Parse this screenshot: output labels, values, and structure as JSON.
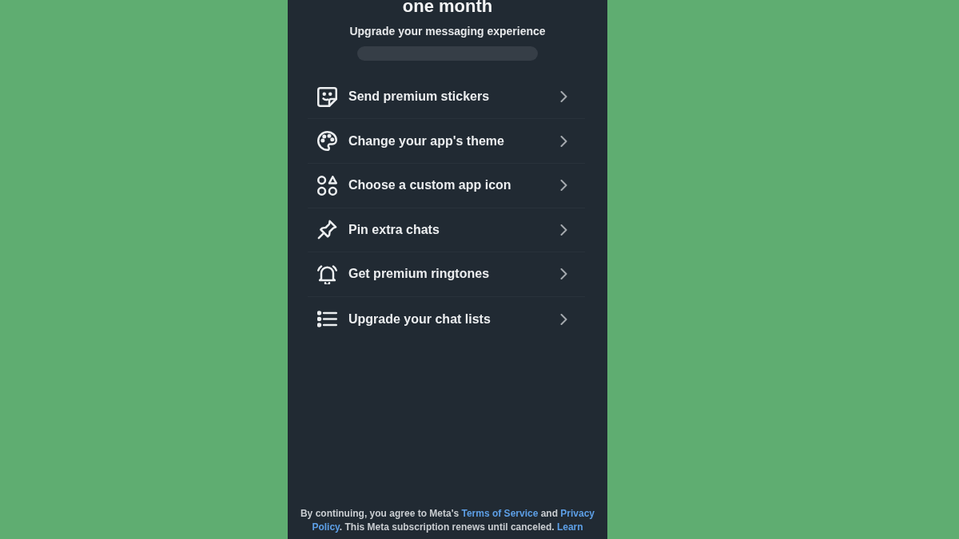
{
  "header": {
    "title": "one month",
    "subtitle": "Upgrade your messaging experience"
  },
  "features": [
    {
      "label": "Send premium stickers"
    },
    {
      "label": "Change your app's theme"
    },
    {
      "label": "Choose a custom app icon"
    },
    {
      "label": "Pin extra chats"
    },
    {
      "label": "Get premium ringtones"
    },
    {
      "label": "Upgrade your chat lists"
    }
  ],
  "legal": {
    "lines": [
      [
        {
          "kind": "text",
          "text": "By continuing, you agree to Meta's "
        },
        {
          "kind": "link",
          "text": "Terms of Service"
        },
        {
          "kind": "text",
          "text": " and "
        },
        {
          "kind": "link",
          "text": "Privacy"
        }
      ],
      [
        {
          "kind": "link",
          "text": "Policy"
        },
        {
          "kind": "text",
          "text": ". This Meta subscription renews until canceled. "
        },
        {
          "kind": "link",
          "text": "Learn"
        }
      ]
    ]
  }
}
